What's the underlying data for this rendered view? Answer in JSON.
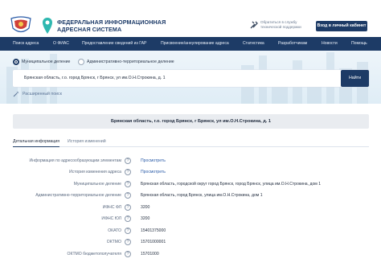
{
  "header": {
    "brand_line1": "ФЕДЕРАЛЬНАЯ ИНФОРМАЦИОННАЯ",
    "brand_line2": "АДРЕСНАЯ СИСТЕМА",
    "support_line1": "Обратиться в службу",
    "support_line2": "технической поддержки",
    "cabinet_button": "Вход в личный кабинет"
  },
  "nav": {
    "items": [
      "Поиск адреса",
      "О ФИАС",
      "Предоставление сведений из ГАР",
      "Присвоение/аннулирование адреса",
      "Статистика",
      "Разработчикам",
      "Новости",
      "Помощь"
    ]
  },
  "search": {
    "radio_municipal": "Муниципальное деление",
    "radio_admin": "Административно-территориальное деление",
    "query": "Брянская область, г.о. город Брянск, г Брянск, ул им.О.Н.Строкина, д. 1",
    "find_button": "Найти",
    "advanced_link": "Расширенный поиск"
  },
  "address_title": "Брянская область, г.о. город Брянск, г Брянск, ул им.О.Н.Строкина, д. 1",
  "tabs": {
    "details": "Детальная информация",
    "history": "История изменений"
  },
  "details": [
    {
      "label": "Информация по адресообразующим элементам",
      "value": "Просмотреть",
      "link": true
    },
    {
      "label": "История изменения адреса",
      "value": "Просмотреть",
      "link": true
    },
    {
      "label": "Муниципальное деление",
      "value": "Брянская область, городской округ город Брянск, город Брянск, улица им.О.Н.Строкина, дом 1",
      "link": false
    },
    {
      "label": "Административно-территориальное деление",
      "value": "Брянская область, город Брянск, улица им.О.Н.Строкина, дом 1",
      "link": false
    },
    {
      "label": "ИФНС ФЛ",
      "value": "3200",
      "link": false
    },
    {
      "label": "ИФНС ЮЛ",
      "value": "3200",
      "link": false
    },
    {
      "label": "ОКАТО",
      "value": "15401375000",
      "link": false
    },
    {
      "label": "ОКТМО",
      "value": "15701000001",
      "link": false
    },
    {
      "label": "ОКТМО бюджетополучателя",
      "value": "15701000",
      "link": false
    }
  ],
  "help_glyph": "?",
  "clear_glyph": "×",
  "colors": {
    "primary": "#1d3b66",
    "link": "#2b5ca8",
    "address_bar_bg": "#e9ecf0"
  }
}
